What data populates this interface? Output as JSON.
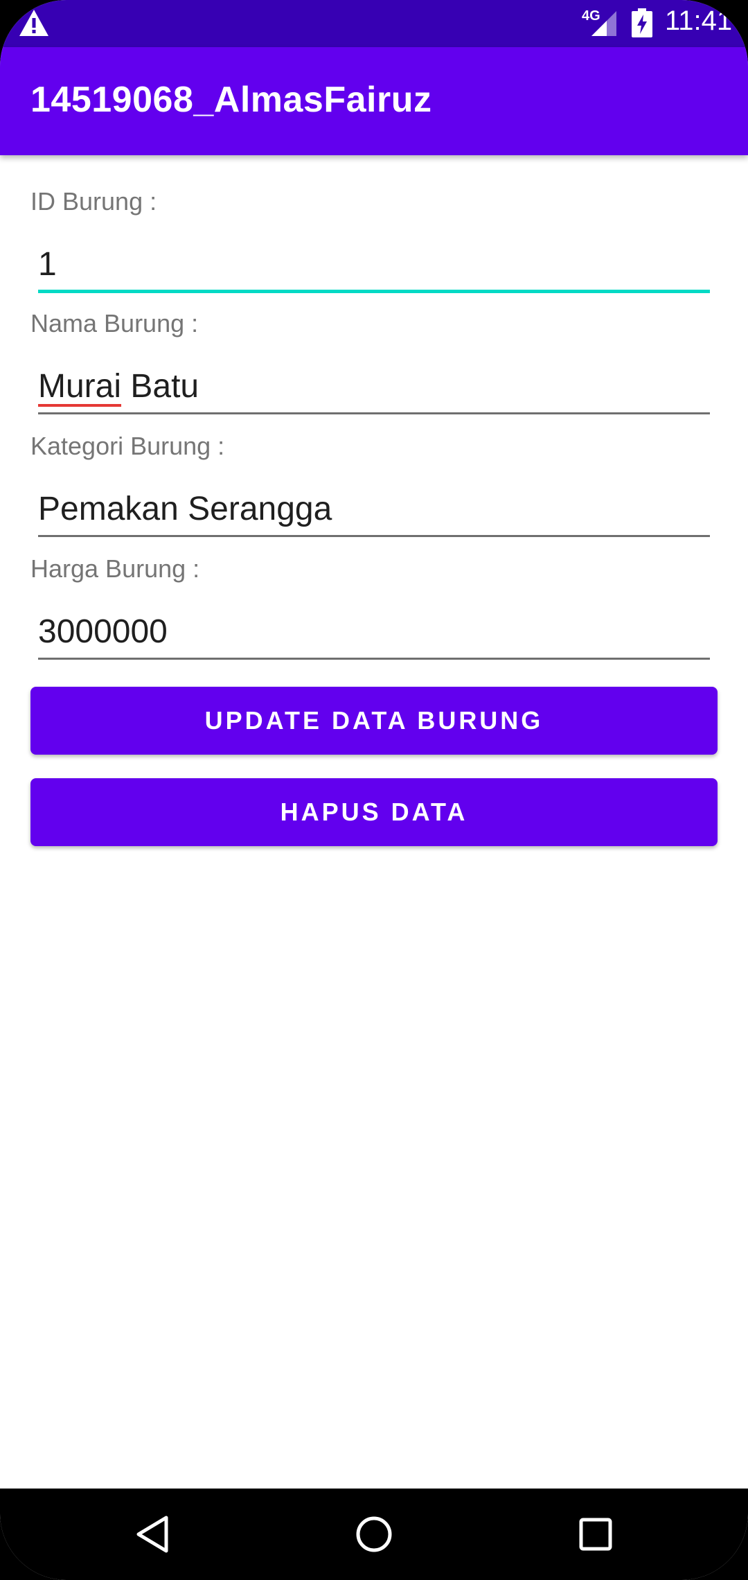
{
  "status_bar": {
    "network_type": "4G",
    "time": "11:41",
    "icons": [
      "warning-icon",
      "signal-icon",
      "battery-charging-icon"
    ]
  },
  "app_bar": {
    "title": "14519068_AlmasFairuz"
  },
  "form": {
    "fields": [
      {
        "label": "ID Burung :",
        "value": "1"
      },
      {
        "label": "Nama Burung :",
        "value_misspelled": "Murai",
        "value_rest": " Batu"
      },
      {
        "label": "Kategori Burung :",
        "value": "Pemakan Serangga"
      },
      {
        "label": "Harga Burung :",
        "value": "3000000"
      }
    ],
    "update_button": "UPDATE DATA BURUNG",
    "delete_button": "HAPUS DATA"
  },
  "nav_bar": {
    "icons": [
      "back-icon",
      "home-icon",
      "recents-icon"
    ]
  },
  "colors": {
    "primary": "#6200EE",
    "primary_dark": "#3700B3",
    "accent": "#03DAC5"
  }
}
